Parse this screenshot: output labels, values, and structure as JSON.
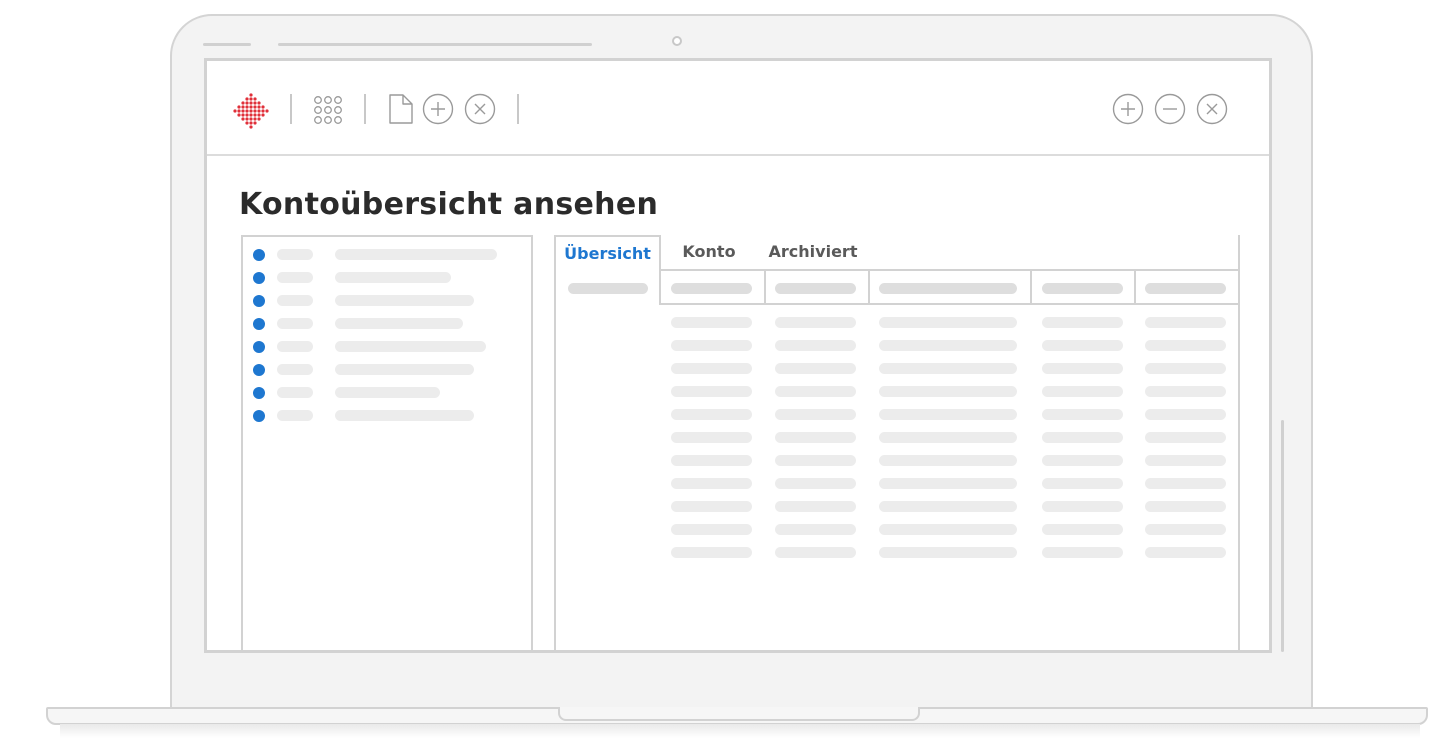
{
  "page": {
    "title": "Kontoübersicht ansehen"
  },
  "toolbar": {
    "left_icons": [
      "logo-icon",
      "grid-icon",
      "document-icon",
      "add-circle-icon",
      "close-circle-icon"
    ],
    "right_icons": [
      "add-circle-icon",
      "minus-circle-icon",
      "close-circle-icon"
    ]
  },
  "tabs": [
    {
      "label": "Übersicht",
      "active": true
    },
    {
      "label": "Konto",
      "active": false
    },
    {
      "label": "Archiviert",
      "active": false
    }
  ],
  "colors": {
    "accent": "#1e77d0",
    "logo": "#e0303a",
    "placeholder": "#ececec",
    "border": "#d2d2d2"
  }
}
